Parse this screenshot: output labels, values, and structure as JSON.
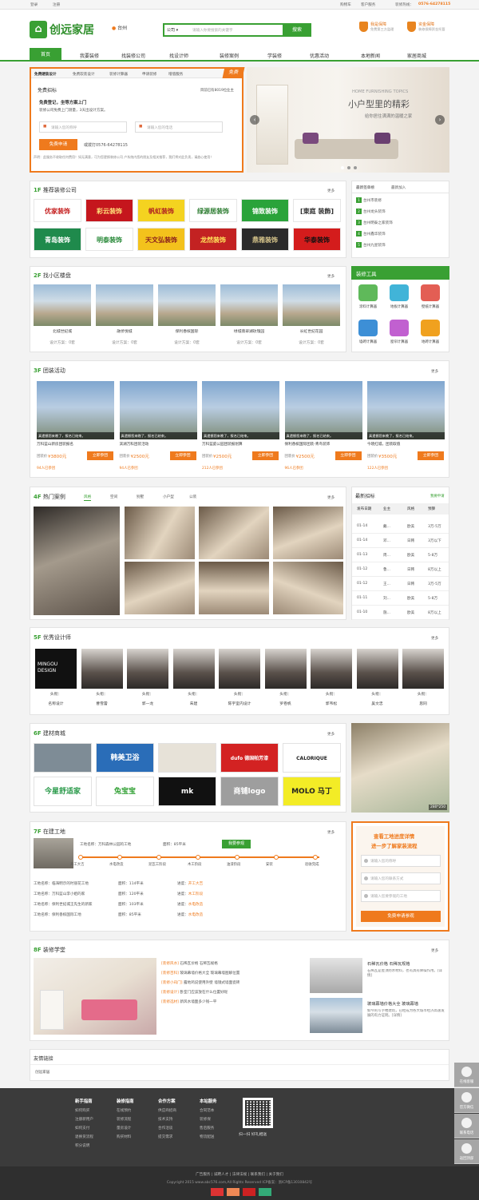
{
  "topbar": {
    "login": "登录",
    "register": "注册",
    "cart": "购物车",
    "service": "客户服务",
    "hotline_label": "装修热线：",
    "hotline": "0576-64278115"
  },
  "header": {
    "logo": "创远家居",
    "city": "台州",
    "search_scope": "公司",
    "search_placeholder": "请输入你要搜索的关键字",
    "search_btn": "搜索",
    "g1": "我是保障",
    "g1s": "免费第三方监理",
    "g2": "资金保障",
    "g2s": "装修保障资金托管"
  },
  "nav": [
    "首页",
    "我要装修",
    "找装修公司",
    "找设计师",
    "装修案例",
    "学装修",
    "优惠活动",
    "本地新闻",
    "家居商城"
  ],
  "apply": {
    "tabs": [
      "免费硬装设计",
      "免费软装设计",
      "装修计算器",
      "申请装修",
      "增值服务"
    ],
    "ribbon": "免费",
    "title": "免费招标",
    "count": "目前已有8019位业主",
    "h2": "免费登记，坐等方案上门",
    "desc": "装修公司免费上门测量，3天出设计方案。",
    "name_ph": "请输入您的称呼",
    "phone_ph": "请输入您的电话",
    "btn": "免费申请",
    "call": "或拨打0576-64278115",
    "note": "声明：此服务不收取任何费用！如无满意，可为您更换装修公司 户系统内您的朋友及相关推荐，我们将对此负责，请放心使用！"
  },
  "banner": {
    "en": "HOME FURNISHING TOPICS",
    "title": "小户型里的精彩",
    "sub": "给你居住满满的温暖之家"
  },
  "f1": {
    "num": "1F",
    "title": "推荐装修公司",
    "more": "更多",
    "logos": [
      {
        "t": "优家装饰",
        "bg": "#ffffff",
        "c": "#c52020"
      },
      {
        "t": "彩云装饰",
        "bg": "#c5161d",
        "c": "#ffe07a"
      },
      {
        "t": "帆虹装饰",
        "bg": "#f4d320",
        "c": "#b02020"
      },
      {
        "t": "绿源居装饰",
        "bg": "#ffffff",
        "c": "#2e7d32"
      },
      {
        "t": "锦致装饰",
        "bg": "#2aa33a",
        "c": "#ffffff"
      },
      {
        "t": "[東庭 装飾]",
        "bg": "#ffffff",
        "c": "#333333"
      },
      {
        "t": "青岛装饰",
        "bg": "#1f8a4c",
        "c": "#ffffff"
      },
      {
        "t": "明泰装饰",
        "bg": "#ffffff",
        "c": "#2a8a3a"
      },
      {
        "t": "天文弘装饰",
        "bg": "#f3c21c",
        "c": "#8a1d1d"
      },
      {
        "t": "龙然装饰",
        "bg": "#c32222",
        "c": "#ffe35a"
      },
      {
        "t": "鼎雅装饰",
        "bg": "#2b2b2b",
        "c": "#d6c48a"
      },
      {
        "t": "华泰装饰",
        "bg": "#d41c1c",
        "c": "#111111"
      }
    ],
    "tabs": [
      "最新签单榜",
      "最新加入"
    ],
    "news": [
      "1 台州市装修",
      "2 台州龙头装饰",
      "3 台州明泰之家装饰",
      "4 台州鑫华装饰",
      "5 台州九星装饰"
    ]
  },
  "f2": {
    "num": "2F",
    "title": "找小区楼盘",
    "more": "更多",
    "items": [
      {
        "name": "北城世纪城",
        "plan": "设计方案：0套"
      },
      {
        "name": "融侨悦城",
        "plan": "设计方案：0套"
      },
      {
        "name": "保利香槟国际",
        "plan": "设计方案：0套"
      },
      {
        "name": "绿城翡翠湖玫瑰园",
        "plan": "设计方案：0套"
      },
      {
        "name": "长虹世纪花园",
        "plan": "设计方案：0套"
      }
    ],
    "tools_title": "装修工具",
    "tools": [
      {
        "name": "涂料计算器",
        "c": "#5fb95a"
      },
      {
        "name": "地板计算器",
        "c": "#41b4d8"
      },
      {
        "name": "壁纸计算器",
        "c": "#e35e54"
      },
      {
        "name": "墙砖计算器",
        "c": "#3d8fd6"
      },
      {
        "name": "窗帘计算器",
        "c": "#c160d0"
      },
      {
        "name": "地砖计算器",
        "c": "#f0a11f"
      }
    ]
  },
  "f3": {
    "num": "3F",
    "title": "团装活动",
    "more": "更多",
    "items": [
      {
        "name": "万科蓝山新房团装报名",
        "price": "¥3800元",
        "joined": "94人已参团",
        "status": "真遗憾您来晚了，报名已结束。"
      },
      {
        "name": "滨湖万科团装活动",
        "price": "¥2500元",
        "joined": "94人已参团",
        "status": "真遗憾您来晚了，报名已结束。"
      },
      {
        "name": "万科蓝庭公园团装报划算",
        "price": "¥2500元",
        "joined": "212人已参团",
        "status": "真遗憾您来晚了，报名已结束。"
      },
      {
        "name": "保利香槟国际团装-青鸟装饰",
        "price": "¥2500元",
        "joined": "96人已参团",
        "status": "真遗憾您来晚了，报名已结束。"
      },
      {
        "name": "今晓红城，团装取值",
        "price": "¥3500元",
        "joined": "122人已参团",
        "status": "真遗憾您来晚了，报名已结束。"
      }
    ],
    "btn": "立即参团",
    "label": "团装价"
  },
  "f4": {
    "num": "4F",
    "title": "热门案例",
    "tabs": [
      "风格",
      "空间",
      "别墅",
      "小户型",
      "公装"
    ],
    "more": "更多",
    "bid_title": "最新招标",
    "bid_more": "我要申请",
    "cols": [
      "发布日期",
      "业主",
      "风格",
      "预算"
    ],
    "bids": [
      [
        "01-14",
        "戴...",
        "欧美",
        "3万-5万"
      ],
      [
        "01-14",
        "邓...",
        "日韩",
        "3万以下"
      ],
      [
        "01-13",
        "周...",
        "欧美",
        "5-8万"
      ],
      [
        "01-12",
        "鲁...",
        "日韩",
        "8万以上"
      ],
      [
        "01-12",
        "王...",
        "日韩",
        "3万-5万"
      ],
      [
        "01-11",
        "刘...",
        "欧美",
        "5-8万"
      ],
      [
        "01-10",
        "施...",
        "欧美",
        "8万以上"
      ]
    ]
  },
  "f5": {
    "num": "5F",
    "title": "优秀设计师",
    "more": "更多",
    "label": "头衔：",
    "names": [
      "名称设计",
      "曹雪蕾",
      "郭一龙",
      "朱建",
      "陈宇室内设计",
      "罗卷帆",
      "郭韦松",
      "吴文忠",
      "思同"
    ],
    "first_logo": "MINGOU DESIGN"
  },
  "f6": {
    "num": "6F",
    "title": "建材商城",
    "more": "更多",
    "brands": [
      {
        "t": "",
        "bg": "#7e8c96",
        "c": "#fff"
      },
      {
        "t": "韩美卫浴",
        "bg": "#2a6db8",
        "c": "#fff"
      },
      {
        "t": "",
        "bg": "#e7e2d8",
        "c": "#555"
      },
      {
        "t": "dufo 德国帕芳漆",
        "bg": "#d32222",
        "c": "#fff"
      },
      {
        "t": "CALORIQUE",
        "bg": "#ffffff",
        "c": "#222"
      },
      {
        "t": "今星舒适家",
        "bg": "#ffffff",
        "c": "#2a9a4a"
      },
      {
        "t": "兔宝宝",
        "bg": "#ffffff",
        "c": "#37a33a"
      },
      {
        "t": "mk",
        "bg": "#111111",
        "c": "#ffffff"
      },
      {
        "t": "商铺logo",
        "bg": "#9e9e9e",
        "c": "#ffffff"
      },
      {
        "t": "MOLO 马丁",
        "bg": "#f3ec26",
        "c": "#222"
      }
    ],
    "ad_size": "280*250"
  },
  "f7": {
    "num": "7F",
    "title": "在建工地",
    "more": "更多",
    "site": "工地名称：万科森林公园的工地",
    "area": "面积：85平米",
    "btn": "我要参观",
    "steps": [
      "开工大吉",
      "水电改造",
      "泥瓦工阶段",
      "木工阶段",
      "油漆阶段",
      "安装",
      "验收完成"
    ],
    "list": [
      [
        "工地名称：临海明示的时丽花工地",
        "面积：114平米",
        "进度：开工大吉"
      ],
      [
        "工地名称：万科蓝山李小姐的家",
        "面积：120平米",
        "进度：木工阶段"
      ],
      [
        "工地名称：保利世纪城王先生的新家",
        "面积：103平米",
        "进度：水电改造"
      ],
      [
        "工地名称：保利香槟国际工地",
        "面积：85平米",
        "进度：水电改造"
      ]
    ],
    "form_t1": "查看工地进度详情",
    "form_t2": "进一步了解家装流程",
    "ph": [
      "请输入您的称呼",
      "请输入您的联系方式",
      "请输入您要参观的工地"
    ],
    "form_btn": "免费申请参观"
  },
  "f8": {
    "num": "8F",
    "title": "装修学堂",
    "more": "更多",
    "lines": [
      "[装修风水] 石稀瓦价格 石稀瓦规格",
      "[装修百科] 玻璃幕墙价格大全 玻璃幕墙图解位置",
      "[装修小窍门] 露地鸡说使用外壁 墙镜式墙面瓷砖",
      "[装修设计] 卧室门应该放在什么位置好呢",
      "[装修选材] 新风水墙面多少钱一平"
    ],
    "a1_title": "石稀瓦价格 石稀瓦规格",
    "a1_text": "石稀瓦是屋顶防水材料，也有具有降噪作用。[详情]",
    "a2_title": "玻璃幕墙价格大全 玻璃幕墙",
    "a2_text": "如今的写字楼建筑，已经成为各大城市经济高速发展的有力证明。[详情]"
  },
  "links": {
    "title": "友情链接",
    "item": "创远家居"
  },
  "footer": {
    "cols": [
      {
        "h": "新手指南",
        "items": [
          "如何购买",
          "注册新用户",
          "如何支付",
          "退换货流程",
          "积分说明"
        ]
      },
      {
        "h": "装修指南",
        "items": [
          "在线预约",
          "装修流程",
          "量房设计",
          "购买材料"
        ]
      },
      {
        "h": "合作方案",
        "items": [
          "供应商招商",
          "技术支持",
          "合作洽谈",
          "提交需求"
        ]
      },
      {
        "h": "本站服务",
        "items": [
          "合同范本",
          "装修保",
          "售后服务",
          "物流配送"
        ]
      }
    ],
    "qr": "扫一扫 好礼相送",
    "links": "广告服务 | 诚聘人才 | 法律法规 | 联系我们 | 关于我们",
    "copy": "Copyright 2015 www.abc576.com,All Rights Reserved ICP备案：浙ICP备13010842号"
  },
  "side": [
    "在线客服",
    "官方微信",
    "联系电话",
    "返回顶部"
  ],
  "colors": {
    "green": "#39a033",
    "orange": "#ef7a1d"
  }
}
